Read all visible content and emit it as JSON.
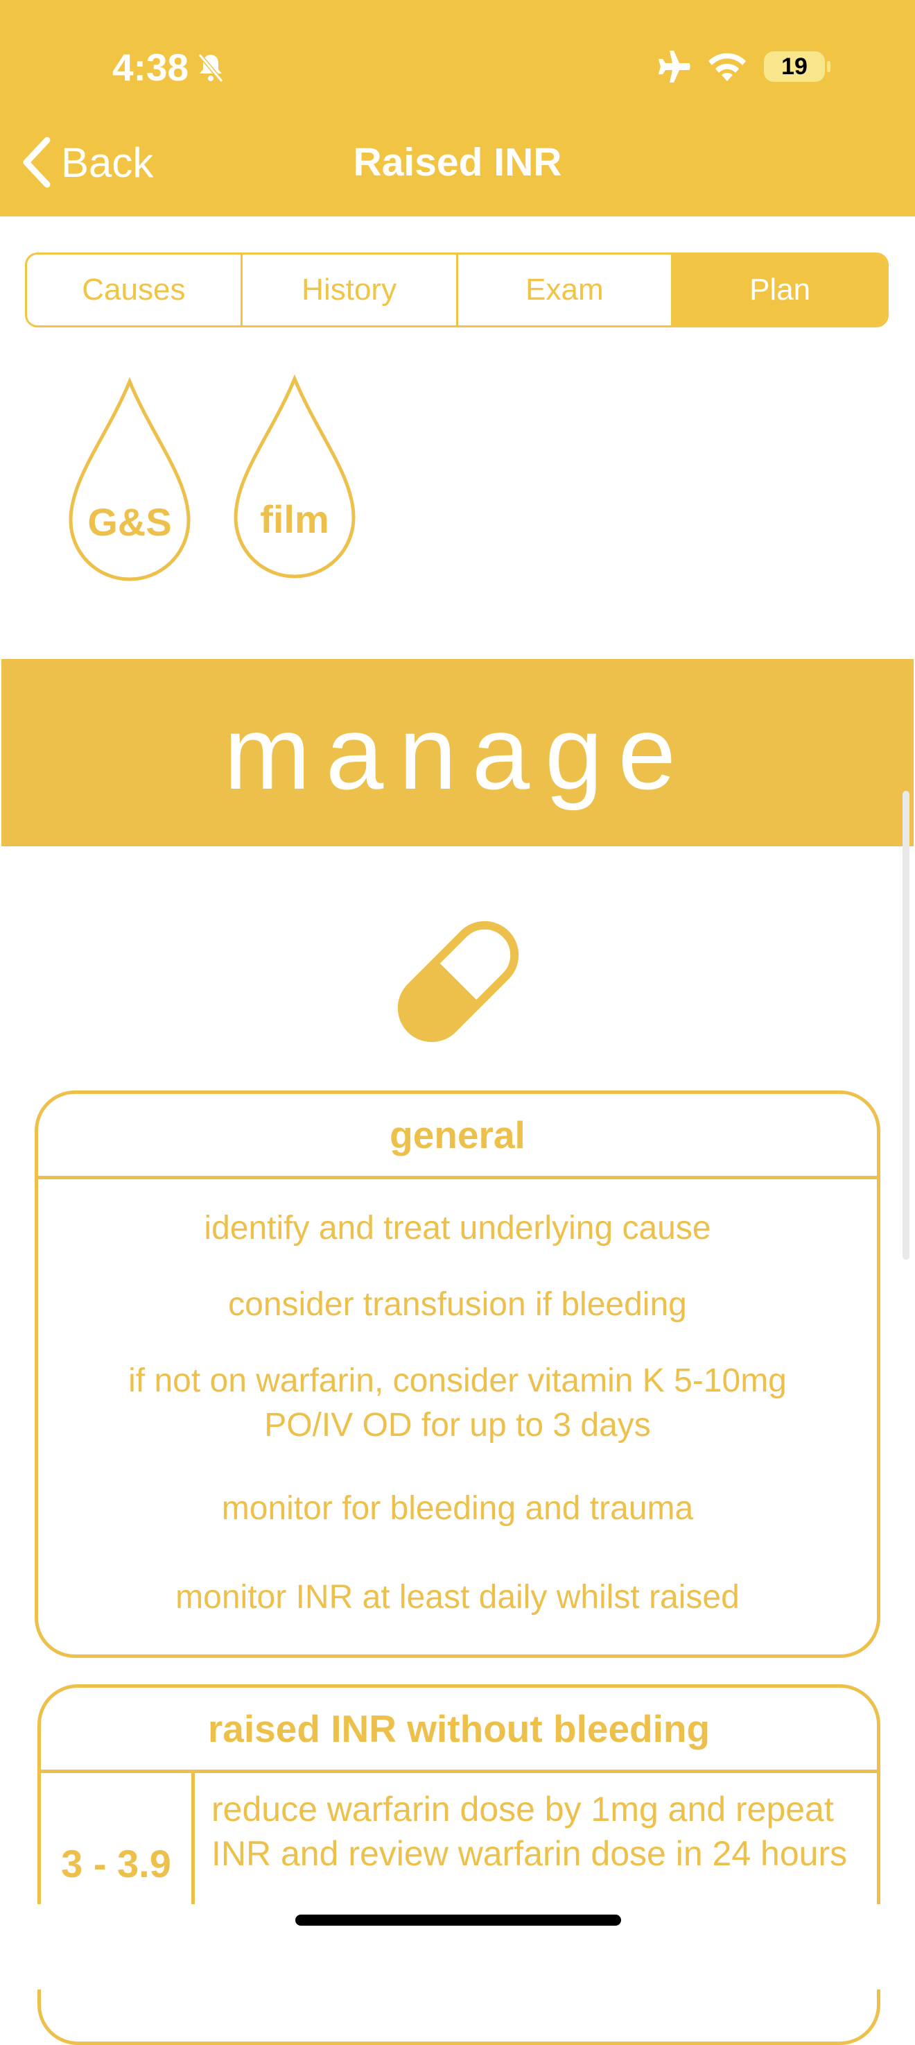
{
  "status_bar": {
    "time": "4:38",
    "battery": "19"
  },
  "nav": {
    "back_label": "Back",
    "title": "Raised INR"
  },
  "tabs": [
    {
      "label": "Causes",
      "active": false
    },
    {
      "label": "History",
      "active": false
    },
    {
      "label": "Exam",
      "active": false
    },
    {
      "label": "Plan",
      "active": true
    }
  ],
  "investigations": [
    "G&S",
    "film"
  ],
  "banner": "manage",
  "general_card": {
    "title": "general",
    "items": [
      "identify and treat underlying cause",
      "consider transfusion if bleeding",
      "if not on warfarin, consider vitamin K 5-10mg PO/IV OD for up to 3 days",
      "monitor for bleeding and trauma",
      "monitor INR at least daily whilst raised"
    ]
  },
  "no_bleeding_card": {
    "title": "raised INR without bleeding",
    "rows": [
      {
        "range": "3 - 3.9",
        "action": "reduce warfarin dose by 1mg and repeat INR and review warfarin dose in 24 hours"
      }
    ]
  },
  "colors": {
    "accent": "#f1c443",
    "banner": "#ecc04b",
    "text": "#ecc04b",
    "white": "#ffffff"
  },
  "icons": [
    "chevron-left-icon",
    "bell-slash-icon",
    "airplane-icon",
    "wifi-icon",
    "battery-icon",
    "blood-drop-icon",
    "pill-icon"
  ]
}
